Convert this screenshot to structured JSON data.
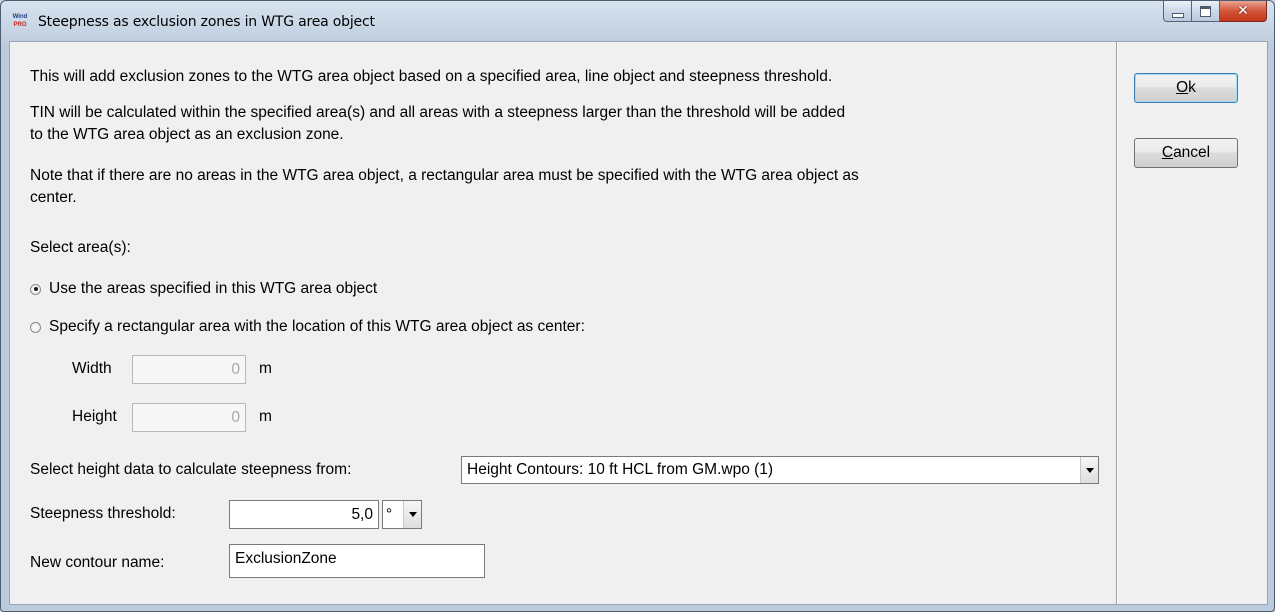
{
  "window": {
    "title": "Steepness as exclusion zones in WTG area object",
    "app_icon": "windpro-icon"
  },
  "description": {
    "line1": "This will add exclusion zones to the WTG area object based on a specified area, line object and steepness threshold.",
    "line2a": "TIN will be calculated within the specified area(s) and all areas with a steepness larger than the threshold will be added",
    "line2b": "to the WTG area object as an exclusion zone.",
    "line3a": "Note that if there are no areas in the WTG area object, a rectangular area must be specified with the WTG area object as",
    "line3b": "center."
  },
  "select_area": {
    "label": "Select area(s):",
    "option_use_label": "Use the areas specified in this WTG area object",
    "option_rect_label": "Specify a rectangular area with the location of this WTG area object as center:",
    "selected": "use"
  },
  "rect": {
    "width_label": "Width",
    "width_value": "0",
    "width_unit": "m",
    "height_label": "Height",
    "height_value": "0",
    "height_unit": "m"
  },
  "height_data": {
    "label": "Select height data to calculate steepness from:",
    "value": "Height Contours: 10 ft HCL from GM.wpo (1)"
  },
  "steepness": {
    "label": "Steepness threshold:",
    "value": "5,0",
    "unit": "°"
  },
  "contour_name": {
    "label": "New contour name:",
    "value": "ExclusionZone"
  },
  "buttons": {
    "ok_accel": "O",
    "ok_rest": "k",
    "cancel_accel": "C",
    "cancel_rest": "ancel"
  }
}
